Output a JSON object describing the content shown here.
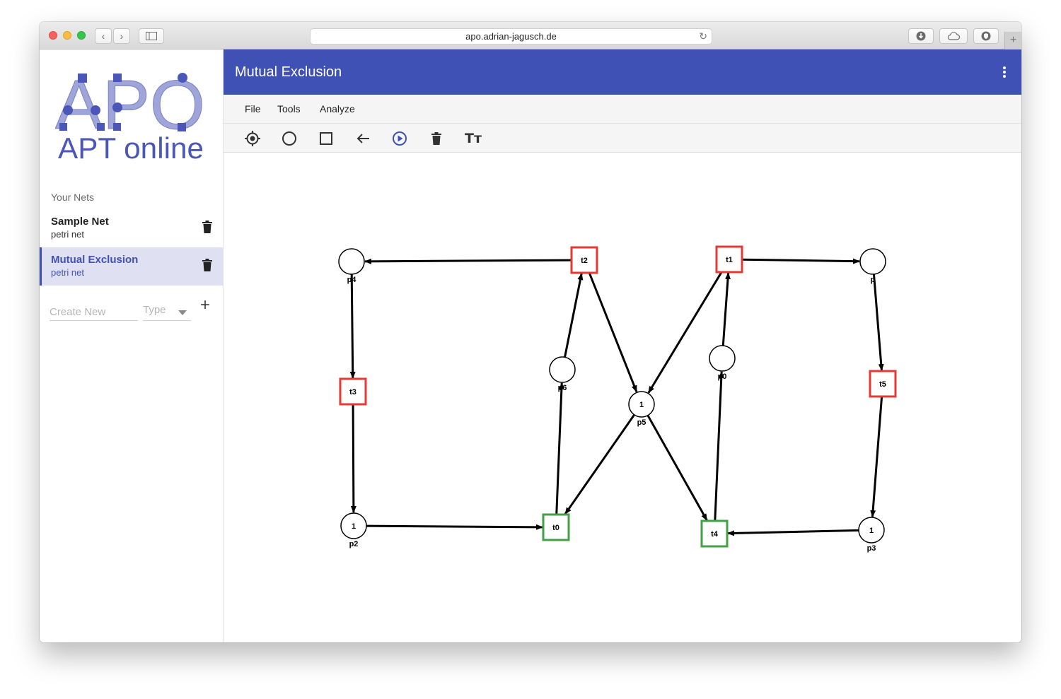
{
  "browser": {
    "url": "apo.adrian-jagusch.de",
    "back_glyph": "‹",
    "forward_glyph": "›",
    "reload_glyph": "↻",
    "newtab_glyph": "+"
  },
  "sidebar": {
    "logo_text": "APO",
    "logo_subtitle": "APT online",
    "section_title": "Your Nets",
    "nets": [
      {
        "name": "Sample Net",
        "type": "petri net"
      },
      {
        "name": "Mutual Exclusion",
        "type": "petri net"
      }
    ],
    "create_placeholder": "Create New",
    "type_placeholder": "Type",
    "add_glyph": "+"
  },
  "appbar": {
    "title": "Mutual Exclusion"
  },
  "menu": {
    "items": [
      "File",
      "Tools",
      "Analyze"
    ]
  },
  "toolbar": {
    "tools": [
      "select-tool-icon",
      "place-tool-icon",
      "transition-tool-icon",
      "arc-tool-icon",
      "play-tool-icon",
      "delete-tool-icon",
      "text-tool-icon"
    ],
    "active_tool": "play-tool-icon",
    "text_tool_glyph": "Tт"
  },
  "colors": {
    "primary": "#3f51b5",
    "disabled_transition": "#e53935",
    "enabled_transition": "#43a047"
  },
  "petri_net": {
    "places": [
      {
        "id": "p4",
        "label": "p4",
        "tokens": ""
      },
      {
        "id": "p",
        "label": "p",
        "tokens": ""
      },
      {
        "id": "p6",
        "label": "p6",
        "tokens": ""
      },
      {
        "id": "p0",
        "label": "p0",
        "tokens": ""
      },
      {
        "id": "p5",
        "label": "p5",
        "tokens": "1"
      },
      {
        "id": "p2",
        "label": "p2",
        "tokens": "1"
      },
      {
        "id": "p3",
        "label": "p3",
        "tokens": "1"
      }
    ],
    "transitions": [
      {
        "id": "t2",
        "label": "t2",
        "enabled": false
      },
      {
        "id": "t1",
        "label": "t1",
        "enabled": false
      },
      {
        "id": "t3",
        "label": "t3",
        "enabled": false
      },
      {
        "id": "t5",
        "label": "t5",
        "enabled": false
      },
      {
        "id": "t0",
        "label": "t0",
        "enabled": true
      },
      {
        "id": "t4",
        "label": "t4",
        "enabled": true
      }
    ],
    "arcs": [
      [
        "t2",
        "p4"
      ],
      [
        "t1",
        "p"
      ],
      [
        "p4",
        "t3"
      ],
      [
        "p",
        "t5"
      ],
      [
        "t3",
        "p2"
      ],
      [
        "t5",
        "p3"
      ],
      [
        "p2",
        "t0"
      ],
      [
        "p3",
        "t4"
      ],
      [
        "t0",
        "p6"
      ],
      [
        "p6",
        "t2"
      ],
      [
        "t4",
        "p0"
      ],
      [
        "p0",
        "t1"
      ],
      [
        "t2",
        "p5"
      ],
      [
        "t1",
        "p5"
      ],
      [
        "p5",
        "t0"
      ],
      [
        "p5",
        "t4"
      ]
    ]
  }
}
